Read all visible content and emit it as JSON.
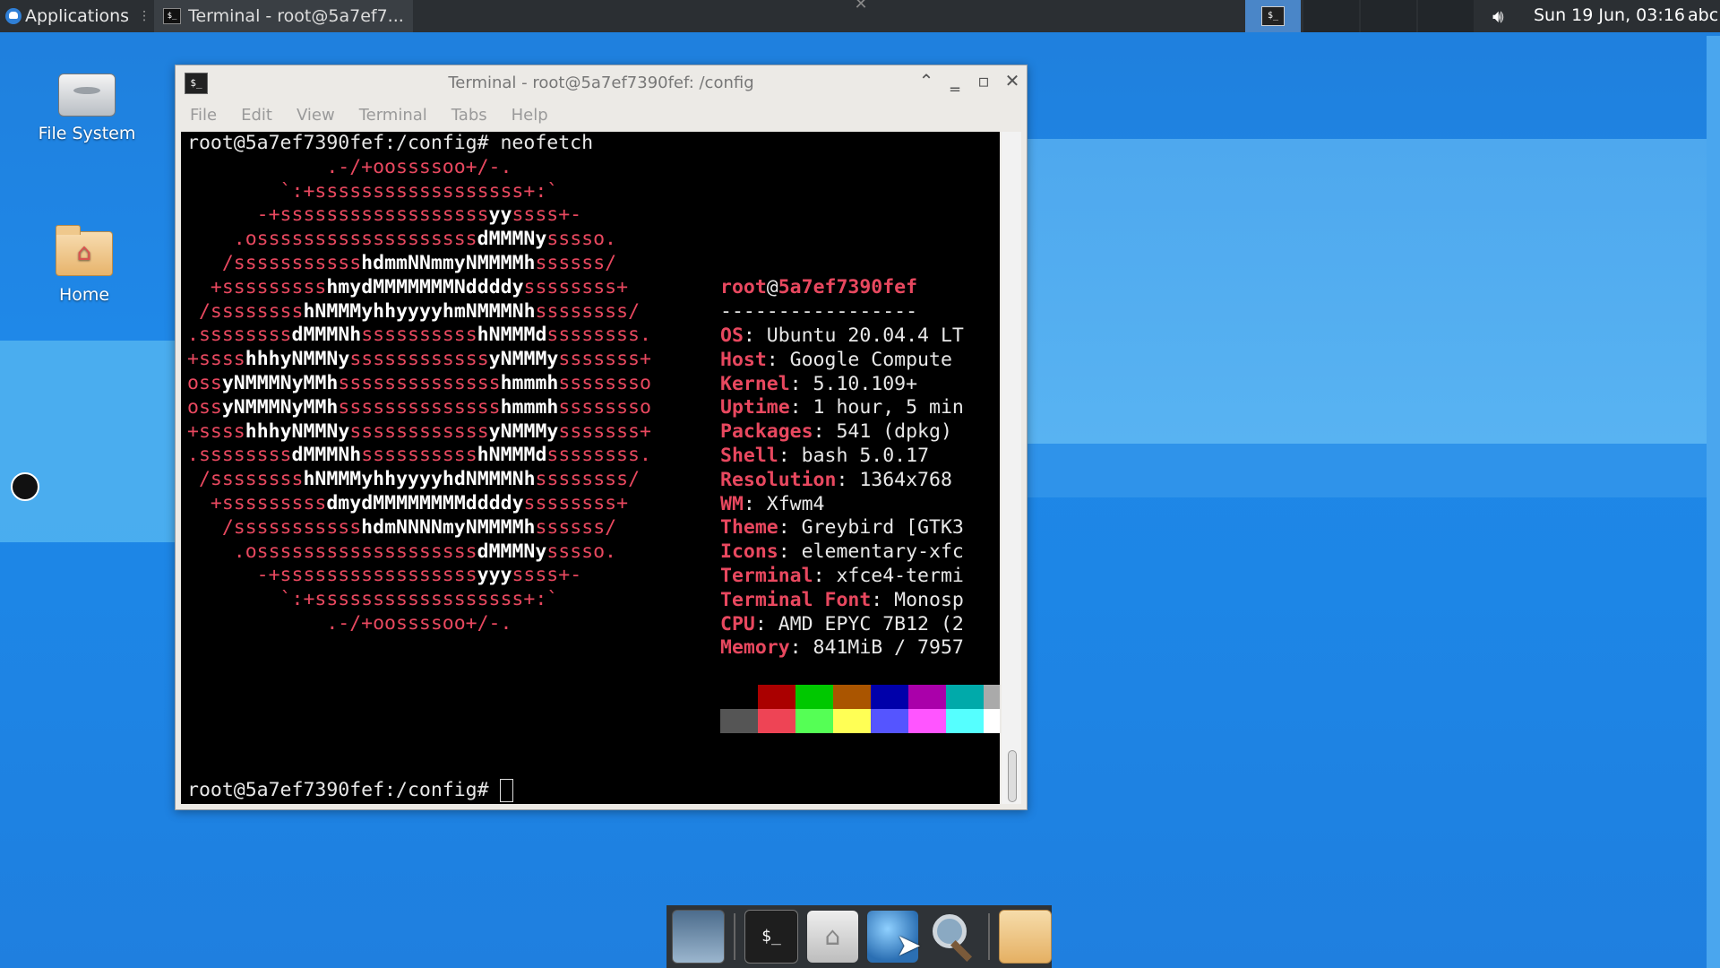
{
  "top_panel": {
    "applications_label": "Applications",
    "task_title": "Terminal - root@5a7ef7...",
    "clock": "Sun 19 Jun, 03:16",
    "keyboard_layout": "abc",
    "volume_icon": "volume-icon"
  },
  "desktop": {
    "icons": [
      {
        "label": "File System",
        "icon": "drive-icon"
      },
      {
        "label": "Home",
        "icon": "home-folder-icon"
      }
    ]
  },
  "window": {
    "title": "Terminal - root@5a7ef7390fef: /config",
    "menu": [
      "File",
      "Edit",
      "View",
      "Terminal",
      "Tabs",
      "Help"
    ]
  },
  "terminal": {
    "prompt_command": "root@5a7ef7390fef:/config# neofetch",
    "prompt_final": "root@5a7ef7390fef:/config#",
    "user": "root",
    "at": "@",
    "host": "5a7ef7390fef",
    "separator": "-----------------",
    "info": [
      {
        "key": "OS",
        "value": ": Ubuntu 20.04.4 LT"
      },
      {
        "key": "Host",
        "value": ": Google Compute"
      },
      {
        "key": "Kernel",
        "value": ": 5.10.109+"
      },
      {
        "key": "Uptime",
        "value": ": 1 hour, 5 min"
      },
      {
        "key": "Packages",
        "value": ": 541 (dpkg)"
      },
      {
        "key": "Shell",
        "value": ": bash 5.0.17"
      },
      {
        "key": "Resolution",
        "value": ": 1364x768"
      },
      {
        "key": "WM",
        "value": ": Xfwm4"
      },
      {
        "key": "Theme",
        "value": ": Greybird [GTK3"
      },
      {
        "key": "Icons",
        "value": ": elementary-xfc"
      },
      {
        "key": "Terminal",
        "value": ": xfce4-termi"
      },
      {
        "key": "Terminal Font",
        "value": ": Monosp"
      },
      {
        "key": "CPU",
        "value": ": AMD EPYC 7B12 (2"
      },
      {
        "key": "Memory",
        "value": ": 841MiB / 7957"
      }
    ],
    "art": [
      "            .-/+oossssoo+/-.",
      "        `:+ssssssssssssssssss+:`",
      "      -+ssssssssssssssssssyyssss+-",
      "    .osssssssssssssssssssdMMMNysssso.",
      "   /ssssssssssshdmmNNmmyNMMMMhssssss/",
      "  +ssssssssshmydMMMMMMMNddddyssssssss+",
      " /sssssssshNMMMyhhyyyyhmNMMMNhssssssss/",
      ".ssssssssdMMMNhsssssssssshNMMMdssssssss.",
      "+sssshhhyNMMNyssssssssssssyNMMMysssssss+",
      "ossyNMMMNyMMhsssssssssssssshmmmhssssssso",
      "ossyNMMMNyMMhsssssssssssssshmmmhssssssso",
      "+sssshhhyNMMNyssssssssssssyNMMMysssssss+",
      ".ssssssssdMMMNhsssssssssshNMMMdssssssss.",
      " /sssssssshNMMMyhhyyyyhdNMMMNhssssssss/",
      "  +sssssssssdmydMMMMMMMMddddyssssssss+",
      "   /ssssssssssshdmNNNNmyNMMMMhssssss/",
      "    .osssssssssssssssssssdMMMNysssso.",
      "      -+sssssssssssssssssyyyssss+-",
      "        `:+ssssssssssssssssss+:`",
      "            .-/+oossssoo+/-."
    ],
    "palette_top": [
      "#000000",
      "#aa0000",
      "#00c800",
      "#aa5500",
      "#0000aa",
      "#aa00aa",
      "#00aaaa",
      "#aaaaaa"
    ],
    "palette_bottom": [
      "#555555",
      "#ee4455",
      "#55ff55",
      "#ffff55",
      "#5555ff",
      "#ff55ff",
      "#55ffff",
      "#ffffff"
    ]
  },
  "dock": {
    "items": [
      "show-desktop-icon",
      "terminal-icon",
      "home-folder-icon",
      "web-browser-icon",
      "search-icon",
      "folder-icon"
    ]
  }
}
